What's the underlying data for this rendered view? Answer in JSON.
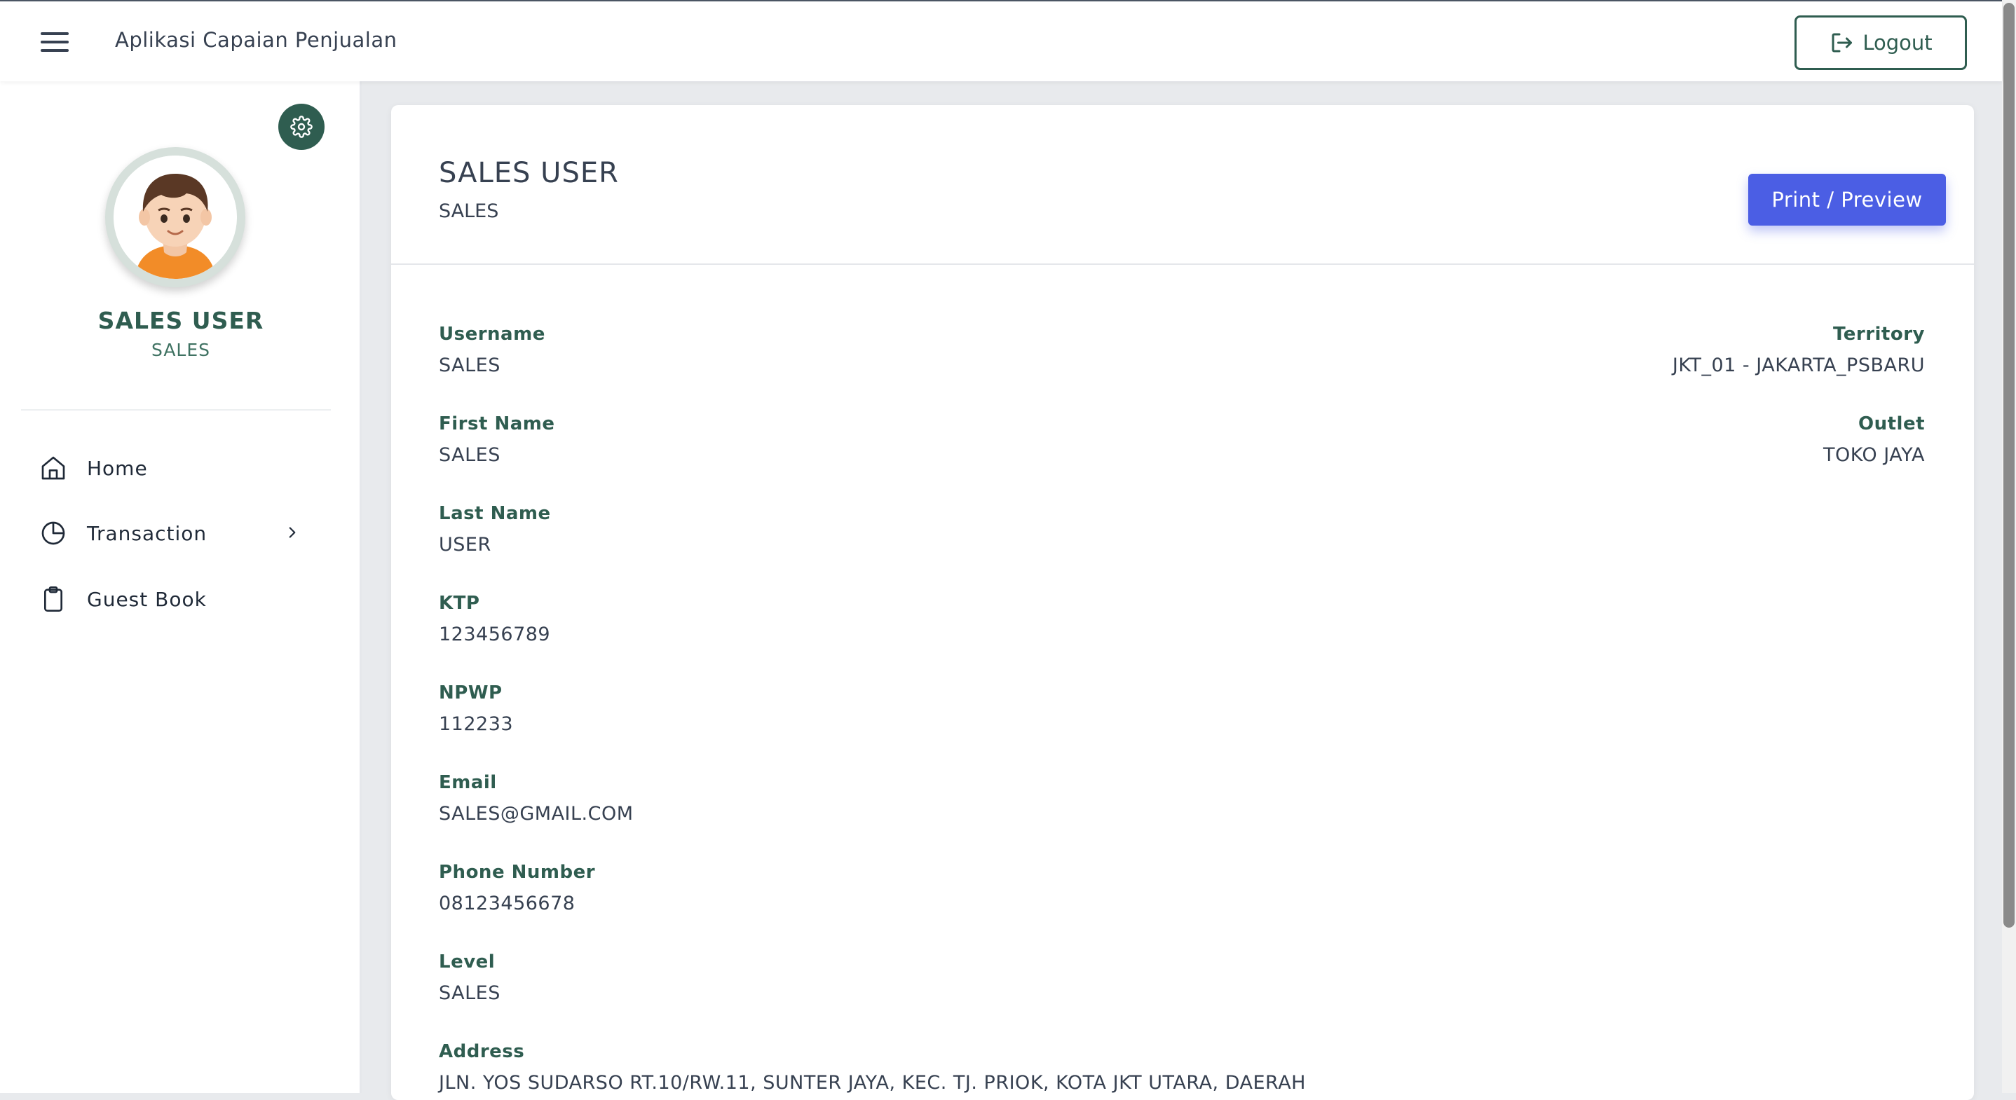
{
  "header": {
    "app_title": "Aplikasi Capaian Penjualan",
    "logout_label": "Logout"
  },
  "sidebar": {
    "profile_name": "SALES USER",
    "profile_role": "SALES",
    "items": [
      {
        "label": "Home",
        "icon": "home-icon"
      },
      {
        "label": "Transaction",
        "icon": "pie-chart-icon"
      },
      {
        "label": "Guest Book",
        "icon": "clipboard-icon"
      }
    ]
  },
  "card": {
    "name": "SALES USER",
    "role": "SALES",
    "print_label": "Print / Preview",
    "fields_left": [
      {
        "label": "Username",
        "value": "SALES"
      },
      {
        "label": "First Name",
        "value": "SALES"
      },
      {
        "label": "Last Name",
        "value": "USER"
      },
      {
        "label": "KTP",
        "value": "123456789"
      },
      {
        "label": "NPWP",
        "value": "112233"
      },
      {
        "label": "Email",
        "value": "SALES@GMAIL.COM"
      },
      {
        "label": "Phone Number",
        "value": "08123456678"
      },
      {
        "label": "Level",
        "value": "SALES"
      },
      {
        "label": "Address",
        "value": "JLN. YOS SUDARSO RT.10/RW.11, SUNTER JAYA, KEC. TJ. PRIOK, KOTA JKT UTARA, DAERAH"
      }
    ],
    "fields_right": [
      {
        "label": "Territory",
        "value": "JKT_01 - JAKARTA_PSBARU"
      },
      {
        "label": "Outlet",
        "value": "TOKO JAYA"
      }
    ]
  },
  "colors": {
    "accent": "#2f5d50",
    "primary_button": "#4b5ee4"
  }
}
